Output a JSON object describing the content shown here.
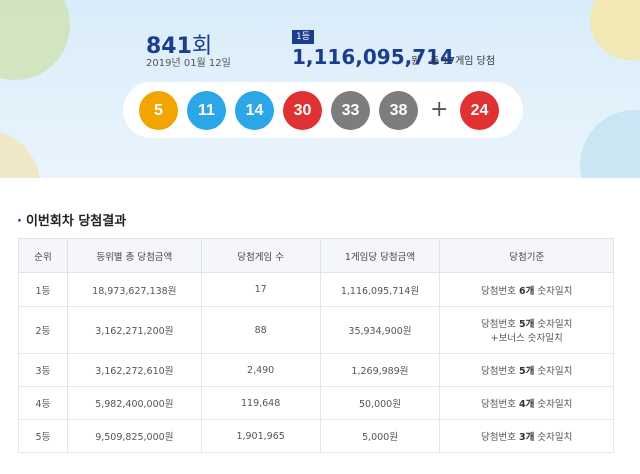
{
  "draw": {
    "round_number": "841",
    "round_suffix": "회",
    "date": "2019년 01월 12일",
    "rank_badge": "1등",
    "first_prize_amount": "1,116,095,714",
    "first_prize_unit": "원",
    "winners_note": "총 17게임 당첨",
    "plus_symbol": "+",
    "numbers": [
      {
        "value": "5",
        "color": "#f2a400"
      },
      {
        "value": "11",
        "color": "#2ba6e6"
      },
      {
        "value": "14",
        "color": "#2ba6e6"
      },
      {
        "value": "30",
        "color": "#e03232"
      },
      {
        "value": "33",
        "color": "#7d7d7d"
      },
      {
        "value": "38",
        "color": "#7d7d7d"
      }
    ],
    "bonus": {
      "value": "24",
      "color": "#e03232"
    }
  },
  "section": {
    "bullet": "·",
    "title": "이번회차 당첨결과"
  },
  "table": {
    "headers": [
      "순위",
      "등위별 총 당첨금액",
      "당첨게임 수",
      "1게임당 당첨금액",
      "당첨기준"
    ],
    "rows": [
      {
        "rank": "1등",
        "total": "18,973,627,138원",
        "games": "17",
        "per_game": "1,116,095,714원",
        "criteria_pre": "당첨번호 ",
        "criteria_bold": "6개",
        "criteria_post": " 숫자일치",
        "criteria_extra": ""
      },
      {
        "rank": "2등",
        "total": "3,162,271,200원",
        "games": "88",
        "per_game": "35,934,900원",
        "criteria_pre": "당첨번호 ",
        "criteria_bold": "5개",
        "criteria_post": " 숫자일치",
        "criteria_extra": "+보너스 숫자일치"
      },
      {
        "rank": "3등",
        "total": "3,162,272,610원",
        "games": "2,490",
        "per_game": "1,269,989원",
        "criteria_pre": "당첨번호 ",
        "criteria_bold": "5개",
        "criteria_post": " 숫자일치",
        "criteria_extra": ""
      },
      {
        "rank": "4등",
        "total": "5,982,400,000원",
        "games": "119,648",
        "per_game": "50,000원",
        "criteria_pre": "당첨번호 ",
        "criteria_bold": "4개",
        "criteria_post": " 숫자일치",
        "criteria_extra": ""
      },
      {
        "rank": "5등",
        "total": "9,509,825,000원",
        "games": "1,901,965",
        "per_game": "5,000원",
        "criteria_pre": "당첨번호 ",
        "criteria_bold": "3개",
        "criteria_post": " 숫자일치",
        "criteria_extra": ""
      }
    ]
  }
}
